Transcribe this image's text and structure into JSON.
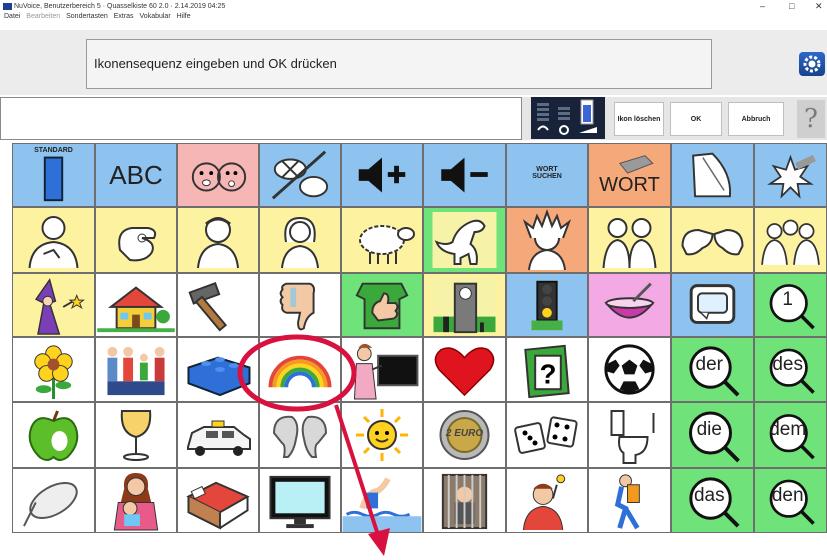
{
  "window": {
    "title": "NuVoice, Benutzerbereich 5 · Quasselkiste 60 2.0 · 2.14.2019 04:25",
    "minimize_glyph": "–",
    "maximize_glyph": "□",
    "close_glyph": "✕"
  },
  "menu": [
    "Datei",
    "Bearbeiten",
    "Sondertasten",
    "Extras",
    "Vokabular",
    "Hilfe"
  ],
  "message": "Ikonensequenz eingeben und OK drücken",
  "input": {
    "value": "",
    "placeholder": ""
  },
  "buttons": {
    "delete_icon": "Ikon löschen",
    "ok": "OK",
    "cancel": "Abbruch",
    "help": "?"
  },
  "colors": {
    "blue": "#8ec2ef",
    "yellow": "#fdf2a0",
    "white": "#ffffff",
    "green": "#6fe37a",
    "pink": "#f7b6b6",
    "orange": "#f5a97a",
    "magenta": "#f2a9e4",
    "grid_line": "#5b5b5b",
    "annotation_red": "#d8113f"
  },
  "rows": [
    [
      {
        "name": "standard-key",
        "icon": "standard-icon",
        "label": "STANDARD",
        "bg": "blue",
        "label_pos": "top"
      },
      {
        "name": "abc-key",
        "icon": "abc-icon",
        "label": "ABC",
        "bg": "blue",
        "label_pos": "big"
      },
      {
        "name": "faces-key",
        "icon": "faces-icon",
        "label": "",
        "bg": "pink"
      },
      {
        "name": "no-speech-key",
        "icon": "no-speech-icon",
        "label": "",
        "bg": "blue"
      },
      {
        "name": "volume-up-key",
        "icon": "volume-up-icon",
        "label": "",
        "bg": "blue"
      },
      {
        "name": "volume-down-key",
        "icon": "volume-down-icon",
        "label": "",
        "bg": "blue"
      },
      {
        "name": "word-search-key",
        "icon": "word-search-icon",
        "label": "WORT SUCHEN",
        "bg": "blue",
        "label_pos": "mid"
      },
      {
        "name": "word-key",
        "icon": "eraser-word-icon",
        "label": "WORT",
        "bg": "orange",
        "label_pos": "word"
      },
      {
        "name": "page-key",
        "icon": "page-icon",
        "label": "",
        "bg": "blue"
      },
      {
        "name": "shatter-key",
        "icon": "shatter-icon",
        "label": "",
        "bg": "blue"
      }
    ],
    [
      {
        "name": "i-key",
        "icon": "person-self-icon",
        "label": "",
        "bg": "yellow"
      },
      {
        "name": "you-key",
        "icon": "pointing-hand-icon",
        "label": "",
        "bg": "yellow"
      },
      {
        "name": "boy-key",
        "icon": "boy-icon",
        "label": "",
        "bg": "yellow"
      },
      {
        "name": "girl-key",
        "icon": "girl-icon",
        "label": "",
        "bg": "yellow"
      },
      {
        "name": "sheep-key",
        "icon": "sheep-icon",
        "label": "",
        "bg": "yellow"
      },
      {
        "name": "dinosaur-key",
        "icon": "dinosaur-icon",
        "label": "",
        "bg": "green"
      },
      {
        "name": "chief-key",
        "icon": "indian-chief-icon",
        "label": "",
        "bg": "orange"
      },
      {
        "name": "couple-key",
        "icon": "couple-icon",
        "label": "",
        "bg": "yellow"
      },
      {
        "name": "hands-key",
        "icon": "pointing-hands-icon",
        "label": "",
        "bg": "yellow"
      },
      {
        "name": "group-key",
        "icon": "group-icon",
        "label": "",
        "bg": "yellow"
      }
    ],
    [
      {
        "name": "wizard-key",
        "icon": "wizard-icon",
        "label": "",
        "bg": "yellow"
      },
      {
        "name": "house-key",
        "icon": "house-icon",
        "label": "",
        "bg": "white"
      },
      {
        "name": "hammer-key",
        "icon": "hammer-icon",
        "label": "",
        "bg": "white"
      },
      {
        "name": "thumb-down-key",
        "icon": "thumb-down-icon",
        "label": "",
        "bg": "white"
      },
      {
        "name": "thumb-up-key",
        "icon": "thumb-up-icon",
        "label": "",
        "bg": "green"
      },
      {
        "name": "clock-tower-key",
        "icon": "clock-tower-icon",
        "label": "",
        "bg": "yellow"
      },
      {
        "name": "traffic-light-key",
        "icon": "traffic-light-icon",
        "label": "",
        "bg": "blue"
      },
      {
        "name": "bowl-key",
        "icon": "bowl-icon",
        "label": "",
        "bg": "magenta"
      },
      {
        "name": "tv-screen-key",
        "icon": "tv-screen-icon",
        "label": "",
        "bg": "blue"
      },
      {
        "name": "number-one-key",
        "icon": "magnifier-one-icon",
        "label": "1",
        "bg": "green",
        "label_pos": "mag"
      }
    ],
    [
      {
        "name": "flower-key",
        "icon": "flower-icon",
        "label": "",
        "bg": "white"
      },
      {
        "name": "family-key",
        "icon": "family-icon",
        "label": "",
        "bg": "white"
      },
      {
        "name": "brick-key",
        "icon": "lego-brick-icon",
        "label": "",
        "bg": "white"
      },
      {
        "name": "rainbow-key",
        "icon": "rainbow-icon",
        "label": "",
        "bg": "white"
      },
      {
        "name": "teacher-key",
        "icon": "teacher-icon",
        "label": "",
        "bg": "white"
      },
      {
        "name": "heart-key",
        "icon": "heart-icon",
        "label": "",
        "bg": "white"
      },
      {
        "name": "question-book-key",
        "icon": "question-book-icon",
        "label": "",
        "bg": "white"
      },
      {
        "name": "ball-key",
        "icon": "soccer-ball-icon",
        "label": "",
        "bg": "white"
      },
      {
        "name": "der-key",
        "icon": "magnifier-icon",
        "label": "der",
        "bg": "green",
        "label_pos": "mag"
      },
      {
        "name": "des-key",
        "icon": "magnifier-icon",
        "label": "des",
        "bg": "green",
        "label_pos": "mag"
      }
    ],
    [
      {
        "name": "apple-key",
        "icon": "apple-icon",
        "label": "",
        "bg": "white"
      },
      {
        "name": "glass-key",
        "icon": "wine-glass-icon",
        "label": "",
        "bg": "white"
      },
      {
        "name": "taxi-key",
        "icon": "taxi-icon",
        "label": "",
        "bg": "white"
      },
      {
        "name": "elephant-key",
        "icon": "elephant-icon",
        "label": "",
        "bg": "white"
      },
      {
        "name": "sun-key",
        "icon": "sun-icon",
        "label": "",
        "bg": "white"
      },
      {
        "name": "euro-key",
        "icon": "euro-coin-icon",
        "label": "2 EURO",
        "bg": "white",
        "label_pos": "coin"
      },
      {
        "name": "dice-key",
        "icon": "dice-icon",
        "label": "",
        "bg": "white"
      },
      {
        "name": "toilet-key",
        "icon": "toilet-icon",
        "label": "",
        "bg": "white"
      },
      {
        "name": "die-key",
        "icon": "magnifier-icon",
        "label": "die",
        "bg": "green",
        "label_pos": "mag"
      },
      {
        "name": "dem-key",
        "icon": "magnifier-icon",
        "label": "dem",
        "bg": "green",
        "label_pos": "mag"
      }
    ],
    [
      {
        "name": "mouse-key",
        "icon": "computer-mouse-icon",
        "label": "",
        "bg": "white"
      },
      {
        "name": "mother-key",
        "icon": "mother-child-icon",
        "label": "",
        "bg": "white"
      },
      {
        "name": "bed-key",
        "icon": "bed-icon",
        "label": "",
        "bg": "white"
      },
      {
        "name": "monitor-key",
        "icon": "monitor-icon",
        "label": "",
        "bg": "white"
      },
      {
        "name": "swimmer-key",
        "icon": "swimmer-icon",
        "label": "",
        "bg": "white"
      },
      {
        "name": "prison-key",
        "icon": "prison-icon",
        "label": "",
        "bg": "white"
      },
      {
        "name": "idea-key",
        "icon": "idea-person-icon",
        "label": "",
        "bg": "white"
      },
      {
        "name": "hiker-key",
        "icon": "hiker-icon",
        "label": "",
        "bg": "white"
      },
      {
        "name": "das-key",
        "icon": "magnifier-icon",
        "label": "das",
        "bg": "green",
        "label_pos": "mag"
      },
      {
        "name": "den-key",
        "icon": "magnifier-icon",
        "label": "den",
        "bg": "green",
        "label_pos": "mag"
      }
    ]
  ]
}
